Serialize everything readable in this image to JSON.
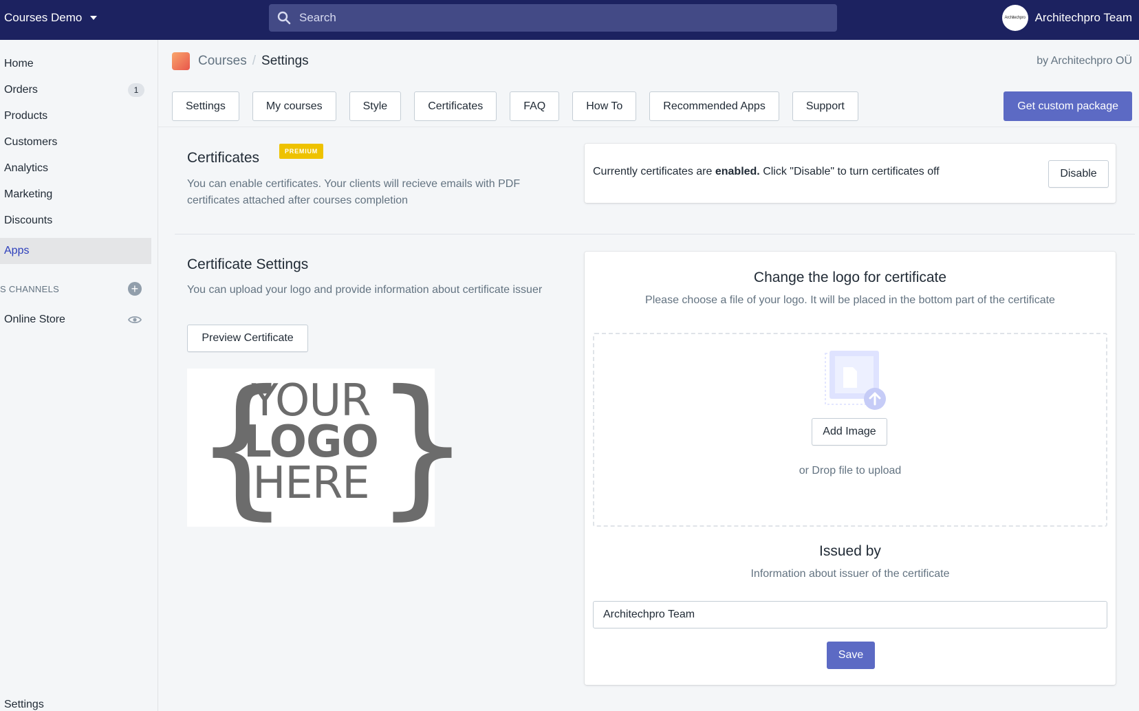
{
  "topbar": {
    "store_name": "Courses Demo",
    "search_placeholder": "Search",
    "account_name": "Architechpro Team",
    "avatar_text": "Architechpro"
  },
  "sidebar": {
    "items": [
      {
        "label": "Home"
      },
      {
        "label": "Orders",
        "badge": "1"
      },
      {
        "label": "Products"
      },
      {
        "label": "Customers"
      },
      {
        "label": "Analytics"
      },
      {
        "label": "Marketing"
      },
      {
        "label": "Discounts"
      },
      {
        "label": "Apps",
        "active": true
      }
    ],
    "channels_heading": "S CHANNELS",
    "channel_items": [
      {
        "label": "Online Store"
      }
    ],
    "bottom_item": "Settings"
  },
  "breadcrumb": {
    "parent": "Courses",
    "separator": "/",
    "current": "Settings"
  },
  "byline": "by Architechpro OÜ",
  "tabs": [
    "Settings",
    "My courses",
    "Style",
    "Certificates",
    "FAQ",
    "How To",
    "Recommended Apps",
    "Support"
  ],
  "custom_package_button": "Get custom package",
  "certificates": {
    "title": "Certificates",
    "badge": "PREMIUM",
    "description": "You can enable certificates. Your clients will recieve emails with PDF certificates attached after courses completion",
    "status_prefix": "Currently certificates are ",
    "status_bold": "enabled.",
    "status_suffix": " Click \"Disable\" to turn certificates off",
    "disable_button": "Disable"
  },
  "certificate_settings": {
    "title": "Certificate Settings",
    "description": "You can upload your logo and provide information about certificate issuer",
    "preview_button": "Preview Certificate",
    "logo_placeholder": {
      "open_brace": "{",
      "close_brace": "}",
      "line1": "YOUR",
      "line2": "LOGO",
      "line3": "HERE"
    }
  },
  "logo_card": {
    "title": "Change the logo for certificate",
    "subtitle": "Please choose a file of your logo. It will be placed in the bottom part of the certificate",
    "add_image_button": "Add Image",
    "drop_hint": "or Drop file to upload"
  },
  "issued_by": {
    "title": "Issued by",
    "subtitle": "Information about issuer of the certificate",
    "input_value": "Architechpro Team",
    "save_button": "Save"
  },
  "colors": {
    "topbar": "#1c2260",
    "primary": "#5c6ac4",
    "premium": "#eec200"
  }
}
